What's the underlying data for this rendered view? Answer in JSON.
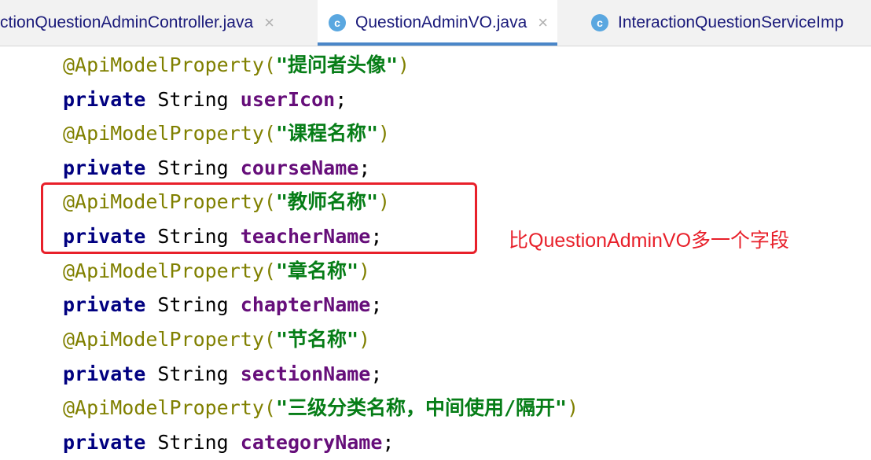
{
  "tabs": [
    {
      "label": "ctionQuestionAdminController.java",
      "icon": "",
      "active": false,
      "close": "×"
    },
    {
      "label": "QuestionAdminVO.java",
      "icon": "c",
      "active": true,
      "close": "×"
    },
    {
      "label": "InteractionQuestionServiceImp",
      "icon": "c",
      "active": false,
      "close": ""
    }
  ],
  "code": [
    {
      "annotation": "@ApiModelProperty(",
      "string": "\"提问者头像\"",
      "close": ")"
    },
    {
      "kw": "private",
      "type": " String ",
      "name": "userIcon",
      "end": ";"
    },
    {
      "annotation": "@ApiModelProperty(",
      "string": "\"课程名称\"",
      "close": ")"
    },
    {
      "kw": "private",
      "type": " String ",
      "name": "courseName",
      "end": ";"
    },
    {
      "annotation": "@ApiModelProperty(",
      "string": "\"教师名称\"",
      "close": ")"
    },
    {
      "kw": "private",
      "type": " String ",
      "name": "teacherName",
      "end": ";"
    },
    {
      "annotation": "@ApiModelProperty(",
      "string": "\"章名称\"",
      "close": ")"
    },
    {
      "kw": "private",
      "type": " String ",
      "name": "chapterName",
      "end": ";"
    },
    {
      "annotation": "@ApiModelProperty(",
      "string": "\"节名称\"",
      "close": ")"
    },
    {
      "kw": "private",
      "type": " String ",
      "name": "sectionName",
      "end": ";"
    },
    {
      "annotation": "@ApiModelProperty(",
      "string": "\"三级分类名称，中间使用/隔开\"",
      "close": ")"
    },
    {
      "kw": "private",
      "type": " String ",
      "name": "categoryName",
      "end": ";"
    }
  ],
  "callout": "比QuestionAdminVO多一个字段",
  "colors": {
    "callout": "#e8202a",
    "annotation": "#808000",
    "keyword": "#000080",
    "field": "#660e7a",
    "string": "#067d17"
  }
}
